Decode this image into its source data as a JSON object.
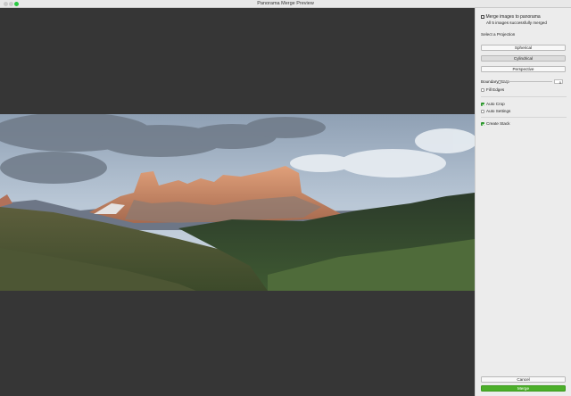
{
  "window": {
    "title": "Panorama Merge Preview"
  },
  "panel": {
    "header_title": "Merge images to panorama",
    "header_subtitle": "All 5 images successfully merged",
    "projection_label": "Select a Projection",
    "projections": [
      "Spherical",
      "Cylindrical",
      "Perspective"
    ],
    "selected_projection": "Cylindrical",
    "boundary_warp_label": "Boundary Warp",
    "boundary_warp_value": "0",
    "fill_edges_label": "Fill Edges",
    "fill_edges_checked": false,
    "auto_crop_label": "Auto Crop",
    "auto_crop_checked": true,
    "auto_settings_label": "Auto Settings",
    "auto_settings_checked": false,
    "create_stack_label": "Create Stack",
    "create_stack_checked": true,
    "cancel_label": "Cancel",
    "merge_label": "Merge"
  },
  "colors": {
    "accent": "#4caf2a",
    "preview_bg": "#363636",
    "panel_bg": "#ececec"
  }
}
